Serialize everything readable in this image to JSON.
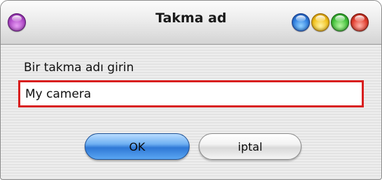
{
  "window": {
    "title": "Takma ad"
  },
  "titlebar": {
    "buttons": [
      {
        "icon": "purple-orb-icon",
        "color": "#b14ac9"
      },
      {
        "icon": "blue-orb-icon",
        "color": "#2f7fe0"
      },
      {
        "icon": "yellow-orb-icon",
        "color": "#f2c21c"
      },
      {
        "icon": "green-orb-icon",
        "color": "#42c23a"
      },
      {
        "icon": "red-orb-icon",
        "color": "#e23d2e"
      }
    ]
  },
  "dialog": {
    "prompt": "Bir takma adı girin",
    "input_value": "My camera",
    "input_border_color": "#d81e1e"
  },
  "actions": {
    "ok_label": "OK",
    "cancel_label": "iptal"
  }
}
